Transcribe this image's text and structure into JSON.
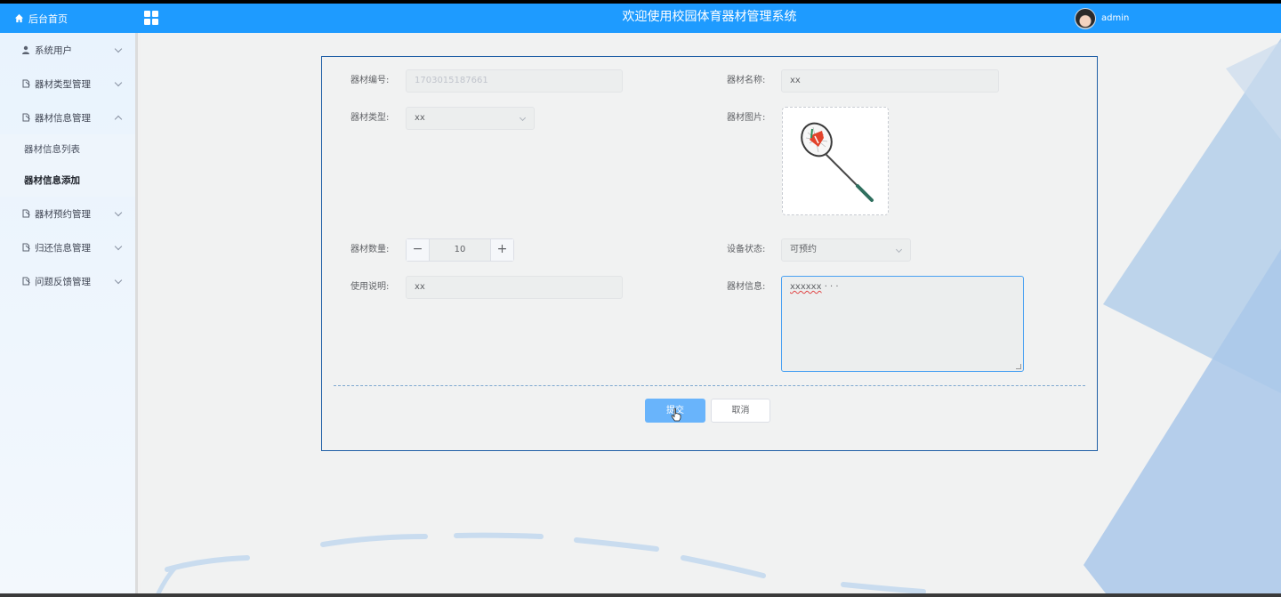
{
  "header": {
    "home_label": "后台首页",
    "title": "欢迎使用校园体育器材管理系统",
    "username": "admin",
    "colors": {
      "bar": "#1e9bff"
    }
  },
  "sidebar": {
    "items": [
      {
        "label": "系统用户",
        "icon": "user-icon",
        "expanded": false
      },
      {
        "label": "器材类型管理",
        "icon": "doc-icon",
        "expanded": false
      },
      {
        "label": "器材信息管理",
        "icon": "doc-icon",
        "expanded": true,
        "children": [
          {
            "label": "器材信息列表",
            "active": false
          },
          {
            "label": "器材信息添加",
            "active": true
          }
        ]
      },
      {
        "label": "器材预约管理",
        "icon": "doc-icon",
        "expanded": false
      },
      {
        "label": "归还信息管理",
        "icon": "doc-icon",
        "expanded": false
      },
      {
        "label": "问题反馈管理",
        "icon": "doc-icon",
        "expanded": false
      }
    ]
  },
  "form": {
    "code_label": "器材编号:",
    "code_value": "1703015187661",
    "name_label": "器材名称:",
    "name_value": "xx",
    "type_label": "器材类型:",
    "type_value": "xx",
    "image_label": "器材图片:",
    "image_icon": "badminton-racket-image",
    "qty_label": "器材数量:",
    "qty_value": "10",
    "qty_minus": "−",
    "qty_plus": "+",
    "status_label": "设备状态:",
    "status_value": "可预约",
    "usage_label": "使用说明:",
    "usage_value": "xx",
    "info_label": "器材信息:",
    "info_value": "xxxxxx",
    "info_suffix": "· · ·",
    "submit_label": "提交",
    "cancel_label": "取消"
  }
}
